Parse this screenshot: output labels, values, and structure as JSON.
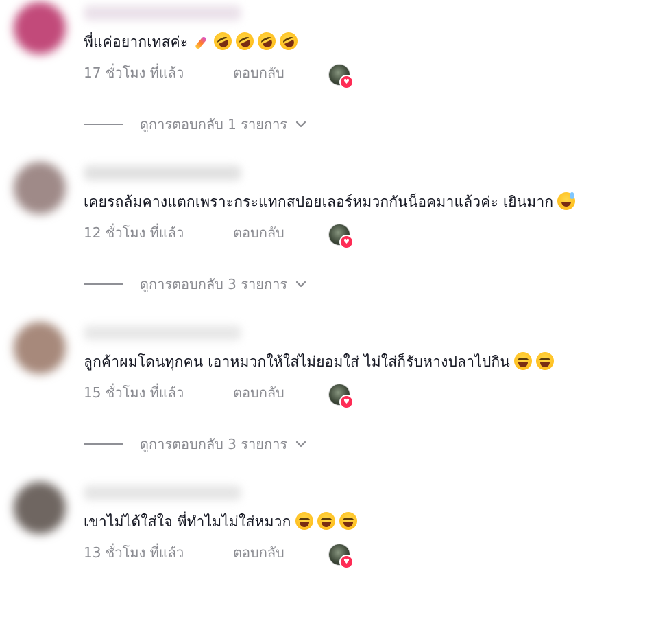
{
  "comments": [
    {
      "avatar_color": "#c24a7a",
      "username_color": "#e7dce6",
      "text": "พี่แค่อยากเทสค่ะ",
      "emojis": [
        "wave",
        "rofl",
        "rofl",
        "rofl",
        "rofl"
      ],
      "time": "17 ชั่วโมง ที่แล้ว",
      "reply_label": "ตอบกลับ",
      "replies_label": "ดูการตอบกลับ 1 รายการ"
    },
    {
      "avatar_color": "#9f8a88",
      "username_color": "#dcdcdc",
      "text": "เคยรถล้มคางแตกเพราะกระแทกสปอยเลอร์หมวกกันน็อคมาแล้วค่ะ เยินมาก",
      "emojis": [
        "sweat"
      ],
      "time": "12 ชั่วโมง ที่แล้ว",
      "reply_label": "ตอบกลับ",
      "replies_label": "ดูการตอบกลับ 3 รายการ"
    },
    {
      "avatar_color": "#a7897b",
      "username_color": "#e4e4e4",
      "text": "ลูกค้าผมโดนทุกคน เอาหมวกให้ใส่ไม่ยอมใส่ ไม่ใส่ก็รับหางปลาไปกิน",
      "emojis": [
        "laugh",
        "laugh"
      ],
      "time": "15 ชั่วโมง ที่แล้ว",
      "reply_label": "ตอบกลับ",
      "replies_label": "ดูการตอบกลับ 3 รายการ"
    },
    {
      "avatar_color": "#6f6661",
      "username_color": "#e1e1e1",
      "text": "เขาไม่ได้ใส่ใจ พี่ทำไมไม่ใส่หมวก",
      "emojis": [
        "laugh",
        "laugh",
        "laugh"
      ],
      "time": "13 ชั่วโมง ที่แล้ว",
      "reply_label": "ตอบกลับ",
      "replies_label": ""
    }
  ],
  "icons": {
    "author_like_heart": "heart-icon",
    "expand": "chevron-down-icon"
  },
  "colors": {
    "text": "#161823",
    "muted": "#8a8b91",
    "heart": "#fe2c55"
  }
}
